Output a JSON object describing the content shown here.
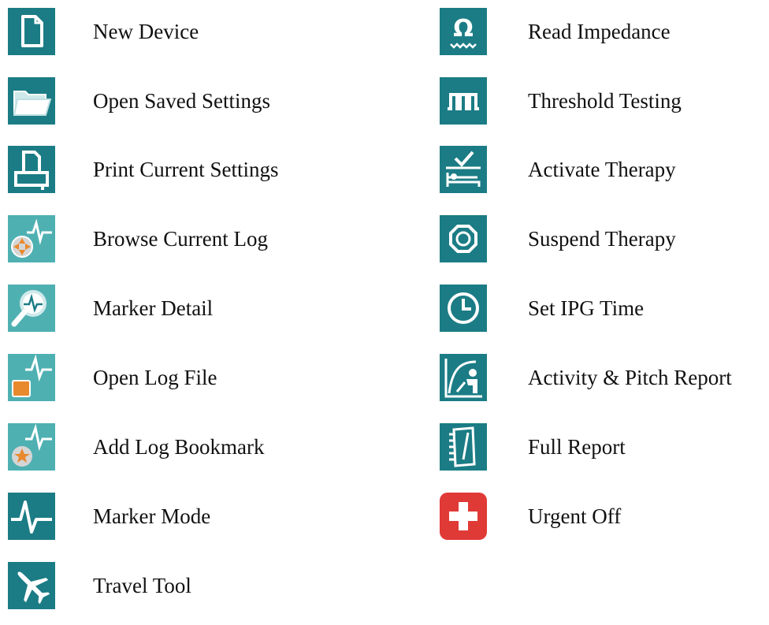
{
  "colors": {
    "teal": "#1b7c85",
    "teal_light": "#4fb0b2",
    "red": "#e03a37",
    "orange": "#e8892e",
    "white": "#ffffff"
  },
  "left_items": [
    {
      "icon": "new-document-icon",
      "label": "New Device"
    },
    {
      "icon": "open-folder-icon",
      "label": "Open Saved Settings"
    },
    {
      "icon": "printer-icon",
      "label": "Print Current Settings"
    },
    {
      "icon": "browse-log-icon",
      "label": "Browse Current Log"
    },
    {
      "icon": "magnifier-waveform-icon",
      "label": "Marker Detail"
    },
    {
      "icon": "open-log-file-icon",
      "label": "Open Log File"
    },
    {
      "icon": "log-bookmark-star-icon",
      "label": "Add Log Bookmark"
    },
    {
      "icon": "waveform-icon",
      "label": "Marker Mode"
    },
    {
      "icon": "airplane-icon",
      "label": "Travel Tool"
    }
  ],
  "right_items": [
    {
      "icon": "ohm-impedance-icon",
      "label": "Read Impedance"
    },
    {
      "icon": "pulse-train-icon",
      "label": "Threshold Testing"
    },
    {
      "icon": "bed-checkmark-icon",
      "label": "Activate Therapy"
    },
    {
      "icon": "octagon-stop-icon",
      "label": "Suspend Therapy"
    },
    {
      "icon": "clock-icon",
      "label": "Set IPG Time"
    },
    {
      "icon": "activity-chart-person-icon",
      "label": "Activity & Pitch Report"
    },
    {
      "icon": "notebook-report-icon",
      "label": "Full Report"
    },
    {
      "icon": "red-cross-icon",
      "label": "Urgent Off"
    }
  ]
}
